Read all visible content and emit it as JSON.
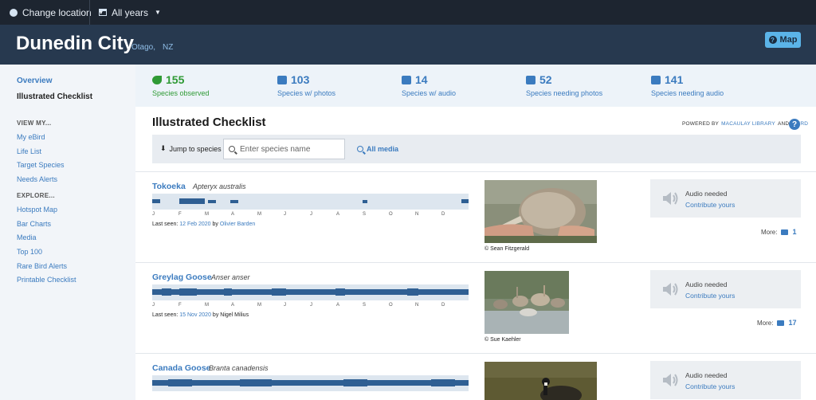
{
  "topbar": {
    "location_label": "Change location",
    "years_label": "All years"
  },
  "header": {
    "title": "Dunedin City",
    "region": "Otago,",
    "country": "NZ",
    "map_label": "Map"
  },
  "sidebar": {
    "overview": "Overview",
    "current": "Illustrated Checklist",
    "view_my_heading": "VIEW MY...",
    "view_my": [
      "My eBird",
      "Life List",
      "Target Species",
      "Needs Alerts"
    ],
    "explore_heading": "EXPLORE...",
    "explore": [
      "Hotspot Map",
      "Bar Charts",
      "Media",
      "Top 100",
      "Rare Bird Alerts",
      "Printable Checklist"
    ]
  },
  "stats": [
    {
      "value": "155",
      "label": "Species observed",
      "icon": "leaf-icon"
    },
    {
      "value": "103",
      "label": "Species w/ photos",
      "icon": "camera-icon"
    },
    {
      "value": "14",
      "label": "Species w/ audio",
      "icon": "speaker-icon"
    },
    {
      "value": "52",
      "label": "Species needing photos",
      "icon": "camera-needed-icon"
    },
    {
      "value": "141",
      "label": "Species needing audio",
      "icon": "speaker-needed-icon"
    }
  ],
  "checklist": {
    "title": "Illustrated Checklist",
    "powered_by": "POWERED BY",
    "macaulay": "MACAULAY LIBRARY",
    "and": "AND",
    "ebird": "EBIRD",
    "help": "?",
    "jump_label": "Jump to species",
    "search_placeholder": "Enter species name",
    "all_media": "All media"
  },
  "months": [
    "J",
    "F",
    "M",
    "A",
    "M",
    "J",
    "J",
    "A",
    "S",
    "O",
    "N",
    "D"
  ],
  "species": [
    {
      "name": "Tokoeka",
      "sci": "Apteryx australis",
      "last_seen_label": "Last seen:",
      "date": "12 Feb 2020",
      "by": "by",
      "observer": "Olivier Barden",
      "credit": "© Sean Fitzgerald",
      "audio_needed": "Audio needed",
      "contribute": "Contribute yours",
      "more_label": "More:",
      "photo_count": "1"
    },
    {
      "name": "Greylag Goose",
      "sci": "Anser anser",
      "last_seen_label": "Last seen:",
      "date": "15 Nov 2020",
      "by": "by",
      "observer": "Nigel Milius",
      "credit": "© Sue Kaehler",
      "audio_needed": "Audio needed",
      "contribute": "Contribute yours",
      "more_label": "More:",
      "photo_count": "17"
    },
    {
      "name": "Canada Goose",
      "sci": "Branta canadensis",
      "audio_needed": "Audio needed",
      "contribute": "Contribute yours"
    }
  ],
  "colors": {
    "topbar": "#1d2530",
    "header": "#27394f",
    "accent": "#3b7bbf",
    "green": "#2f9a35",
    "bar_fill": "#2f5f93"
  }
}
